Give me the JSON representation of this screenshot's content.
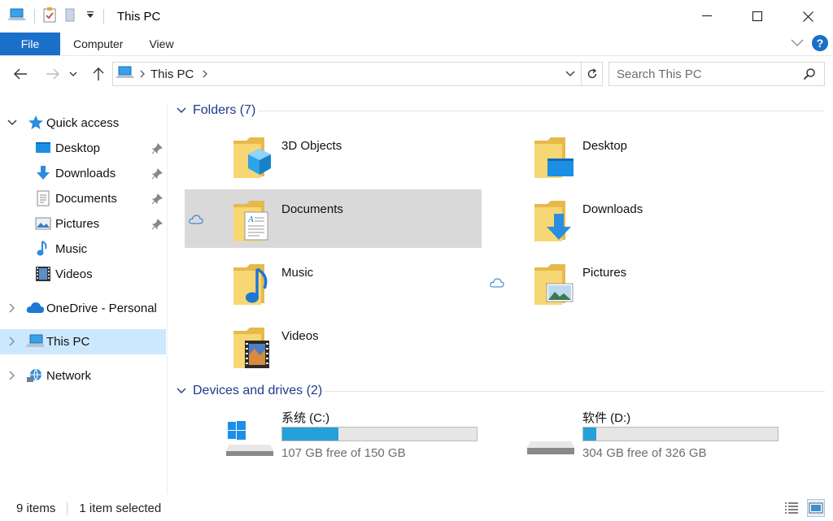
{
  "window": {
    "title": "This PC"
  },
  "ribbon": {
    "tabs": [
      {
        "label": "File"
      },
      {
        "label": "Computer"
      },
      {
        "label": "View"
      }
    ],
    "help_label": "?"
  },
  "address": {
    "crumb": "This PC",
    "search_placeholder": "Search This PC"
  },
  "sidebar": {
    "quick_access": "Quick access",
    "quick_items": [
      {
        "label": "Desktop",
        "pinned": true
      },
      {
        "label": "Downloads",
        "pinned": true
      },
      {
        "label": "Documents",
        "pinned": true
      },
      {
        "label": "Pictures",
        "pinned": true
      },
      {
        "label": "Music",
        "pinned": false
      },
      {
        "label": "Videos",
        "pinned": false
      }
    ],
    "onedrive": "OneDrive - Personal",
    "this_pc": "This PC",
    "network": "Network"
  },
  "main": {
    "folders_header": "Folders (7)",
    "folders": [
      {
        "label": "3D Objects"
      },
      {
        "label": "Desktop"
      },
      {
        "label": "Documents"
      },
      {
        "label": "Downloads"
      },
      {
        "label": "Music"
      },
      {
        "label": "Pictures"
      },
      {
        "label": "Videos"
      }
    ],
    "drives_header": "Devices and drives (2)",
    "drives": [
      {
        "label": "系统 (C:)",
        "free": "107 GB free of 150 GB",
        "used_fraction": 0.287
      },
      {
        "label": "软件 (D:)",
        "free": "304 GB free of 326 GB",
        "used_fraction": 0.067
      }
    ]
  },
  "status": {
    "items": "9 items",
    "selected": "1 item selected"
  },
  "colors": {
    "accent": "#1a6fc9",
    "selection": "#cce8ff",
    "drive_fill": "#26a0da",
    "group_header": "#1e3a8a"
  }
}
